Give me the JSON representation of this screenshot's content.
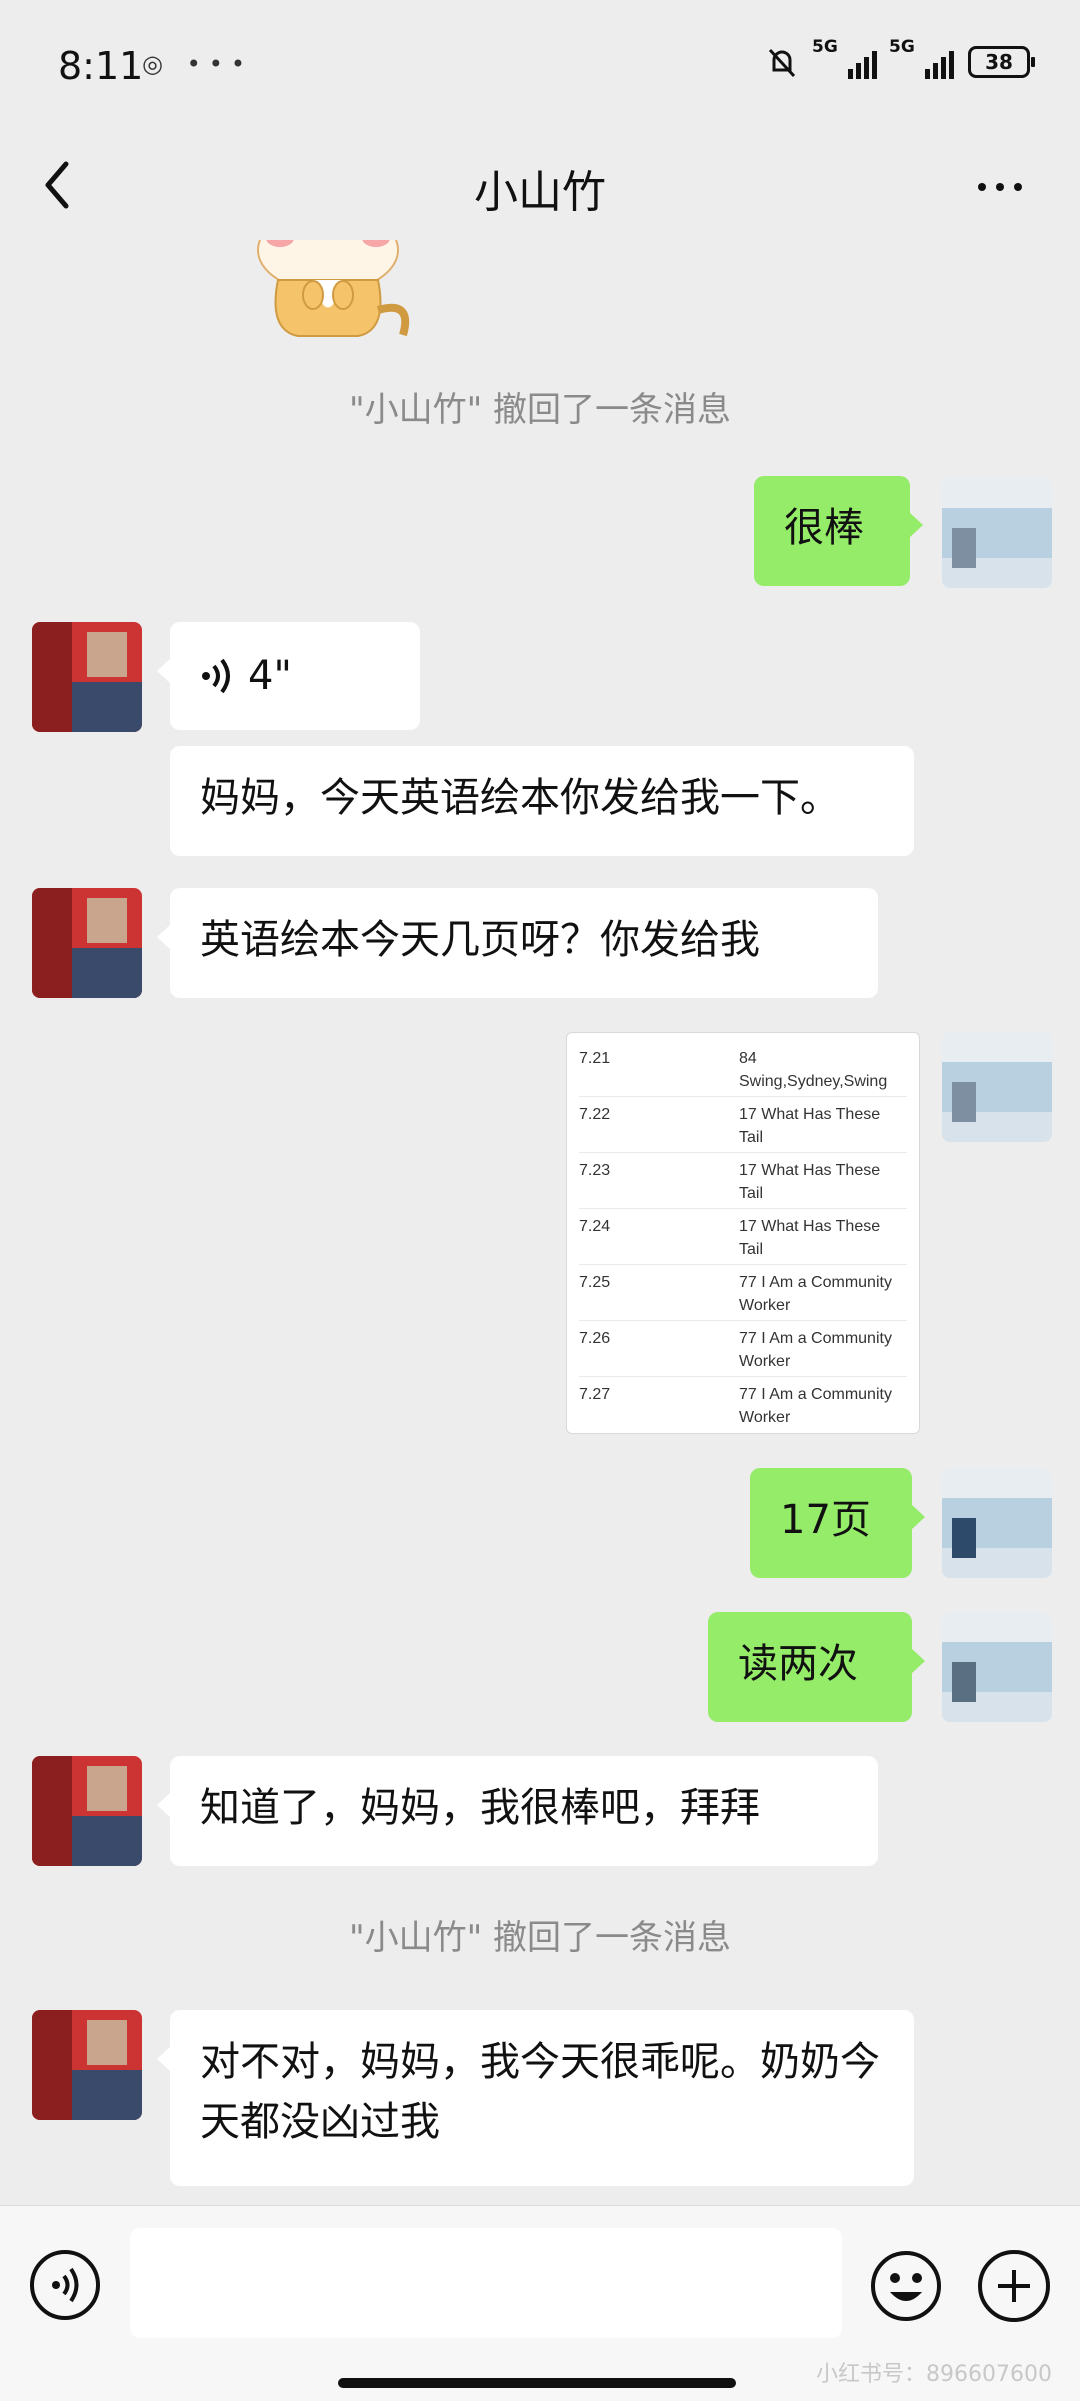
{
  "status": {
    "time": "8:11",
    "battery": "38",
    "net1": "5G",
    "net2": "5G"
  },
  "header": {
    "title": "小山竹"
  },
  "messages": {
    "recall1": "\"小山竹\" 撤回了一条消息",
    "out_great": "很棒",
    "voice_duration": "4\"",
    "in_1": "妈妈，今天英语绘本你发给我一下。",
    "in_2": "英语绘本今天几页呀？你发给我",
    "out_pages": "17页",
    "out_read_twice": "读两次",
    "in_3": "知道了，妈妈，我很棒吧，拜拜",
    "recall2": "\"小山竹\" 撤回了一条消息",
    "in_4": "对不对，妈妈，我今天很乖呢。奶奶今天都没凶过我"
  },
  "image_table": [
    {
      "date": "7.21",
      "title": "84 Swing,Sydney,Swing"
    },
    {
      "date": "7.22",
      "title": "17 What Has These Tail"
    },
    {
      "date": "7.23",
      "title": "17 What Has These Tail"
    },
    {
      "date": "7.24",
      "title": "17 What Has These Tail"
    },
    {
      "date": "7.25",
      "title": "77 I Am a Community Worker"
    },
    {
      "date": "7.26",
      "title": "77 I Am a Community Worker"
    },
    {
      "date": "7.27",
      "title": "77 I Am a Community Worker"
    }
  ],
  "watermark": "小红书号：896607600",
  "colors": {
    "out_bubble": "#95ec69",
    "in_bubble": "#ffffff",
    "background": "#ededed"
  }
}
